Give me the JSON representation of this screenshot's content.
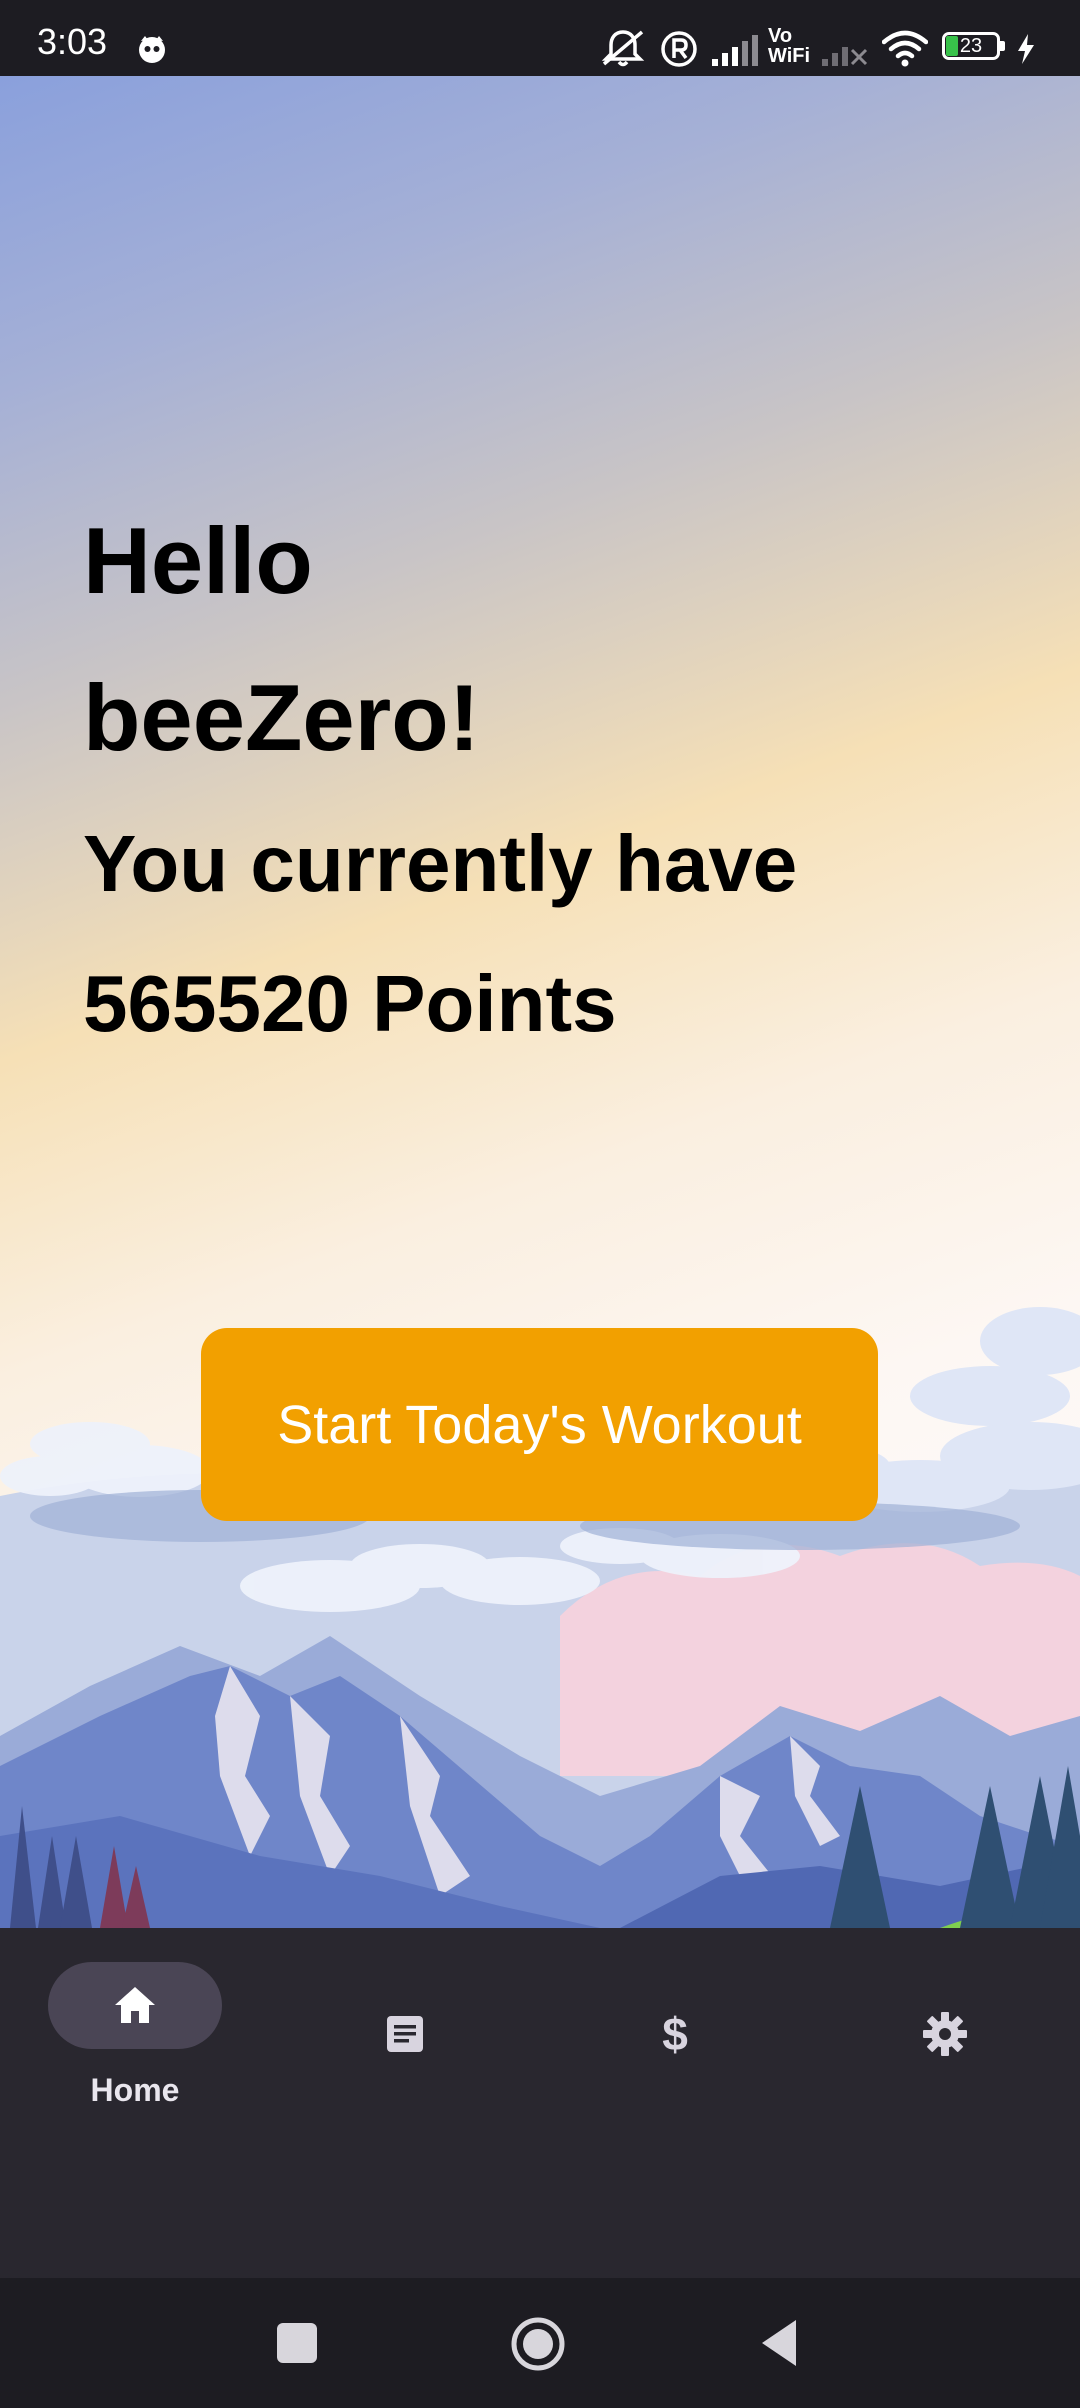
{
  "status_bar": {
    "time": "3:03",
    "battery_level": "23",
    "icons": [
      "notification-face-icon",
      "mute-icon",
      "registered-icon",
      "signal-icon",
      "vowifi-icon",
      "signal-off-icon",
      "wifi-icon",
      "battery-icon",
      "charging-icon"
    ],
    "vowifi_top": "Vo",
    "vowifi_bottom": "WiFi"
  },
  "home": {
    "greeting_line1": "Hello",
    "greeting_line2": "beeZero!",
    "points_line1": "You currently have",
    "points_line2": "565520 Points",
    "start_button_label": "Start Today's Workout"
  },
  "bottom_nav": {
    "items": [
      {
        "icon": "home-icon",
        "label": "Home",
        "active": true
      },
      {
        "icon": "document-icon",
        "label": "",
        "active": false
      },
      {
        "icon": "dollar-icon",
        "label": "",
        "active": false
      },
      {
        "icon": "gear-icon",
        "label": "",
        "active": false
      }
    ]
  },
  "system_nav": {
    "buttons": [
      "recents-button",
      "home-button",
      "back-button"
    ]
  },
  "colors": {
    "accent_button": "#f2a000",
    "nav_background": "#29272f",
    "nav_active_pill": "#4a4555",
    "status_bar_background": "#1d1c22"
  }
}
